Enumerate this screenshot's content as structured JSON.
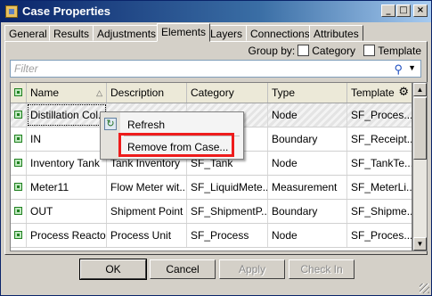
{
  "window": {
    "title": "Case Properties"
  },
  "title_buttons": {
    "minimize": "_",
    "maximize": "□",
    "close": "×"
  },
  "tabs": [
    {
      "label": "General"
    },
    {
      "label": "Results"
    },
    {
      "label": "Adjustments"
    },
    {
      "label": "Elements",
      "active": true
    },
    {
      "label": "Layers"
    },
    {
      "label": "Connections"
    },
    {
      "label": "Attributes"
    }
  ],
  "group_by": {
    "label": "Group by:",
    "options": [
      {
        "label": "Category",
        "checked": false
      },
      {
        "label": "Template",
        "checked": false
      }
    ]
  },
  "filter": {
    "placeholder": "Filter",
    "icon": "search-icon"
  },
  "table": {
    "columns": [
      "Name",
      "Description",
      "Category",
      "Type",
      "Template"
    ],
    "sort_column": "Name",
    "rows": [
      {
        "name": "Distillation Col...",
        "description": "",
        "category": "",
        "type": "Node",
        "template": "SF_Proces...",
        "selected": true
      },
      {
        "name": "IN",
        "description": "",
        "category": "",
        "type": "Boundary",
        "template": "SF_Receipt..."
      },
      {
        "name": "Inventory Tank",
        "description": "Tank Inventory",
        "category": "SF_Tank",
        "type": "Node",
        "template": "SF_TankTe..."
      },
      {
        "name": "Meter11",
        "description": "Flow Meter wit...",
        "category": "SF_LiquidMete...",
        "type": "Measurement",
        "template": "SF_MeterLi..."
      },
      {
        "name": "OUT",
        "description": "Shipment Point",
        "category": "SF_ShipmentP...",
        "type": "Boundary",
        "template": "SF_Shipme..."
      },
      {
        "name": "Process Reactor",
        "description": "Process Unit",
        "category": "SF_Process",
        "type": "Node",
        "template": "SF_Proces..."
      }
    ]
  },
  "context_menu": {
    "items": [
      {
        "label": "Refresh",
        "icon": "refresh-icon"
      },
      {
        "label": "Remove from Case..."
      }
    ],
    "highlight_color": "#ee1c1c"
  },
  "buttons": {
    "ok": "OK",
    "cancel": "Cancel",
    "apply": "Apply",
    "check_in": "Check In"
  }
}
